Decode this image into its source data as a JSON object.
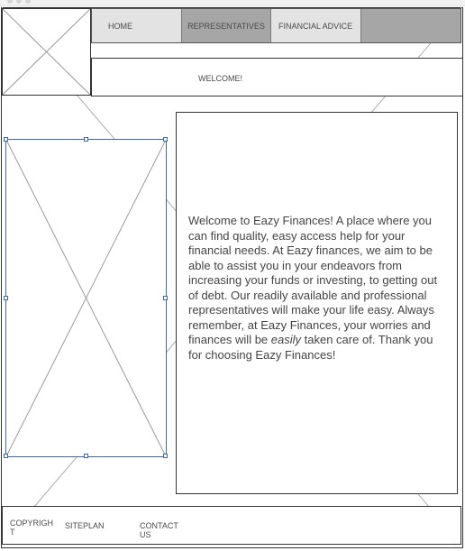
{
  "nav": {
    "home": "HOME",
    "representatives": "REPRESENTATIVES",
    "financial_advice": "FINANCIAL ADVICE"
  },
  "welcome": {
    "label": "WELCOME!"
  },
  "content": {
    "intro": "Welcome to Eazy Finances! A place where you can find quality, easy access help for your financial needs. At Eazy finances, we aim to be able to assist you in your endeavors from increasing your funds or investing, to getting out of debt. Our readily available and professional representatives will make your life easy. Always remember, at Eazy Finances, your worries and finances will be ",
    "emphasis": "easily",
    "outro": " taken care of. Thank you for choosing Eazy Finances!"
  },
  "footer": {
    "copyright": "COPYRIGHT",
    "siteplan": "SITEPLAN",
    "contact": "CONTACT US"
  },
  "colors": {
    "nav_active": "#a6a6a6",
    "nav_default": "#e3e3e3",
    "selection": "#3d66b5",
    "border": "#333333"
  },
  "icons": {
    "logo_placeholder": "image-placeholder-icon",
    "main_image_placeholder": "image-placeholder-icon"
  }
}
